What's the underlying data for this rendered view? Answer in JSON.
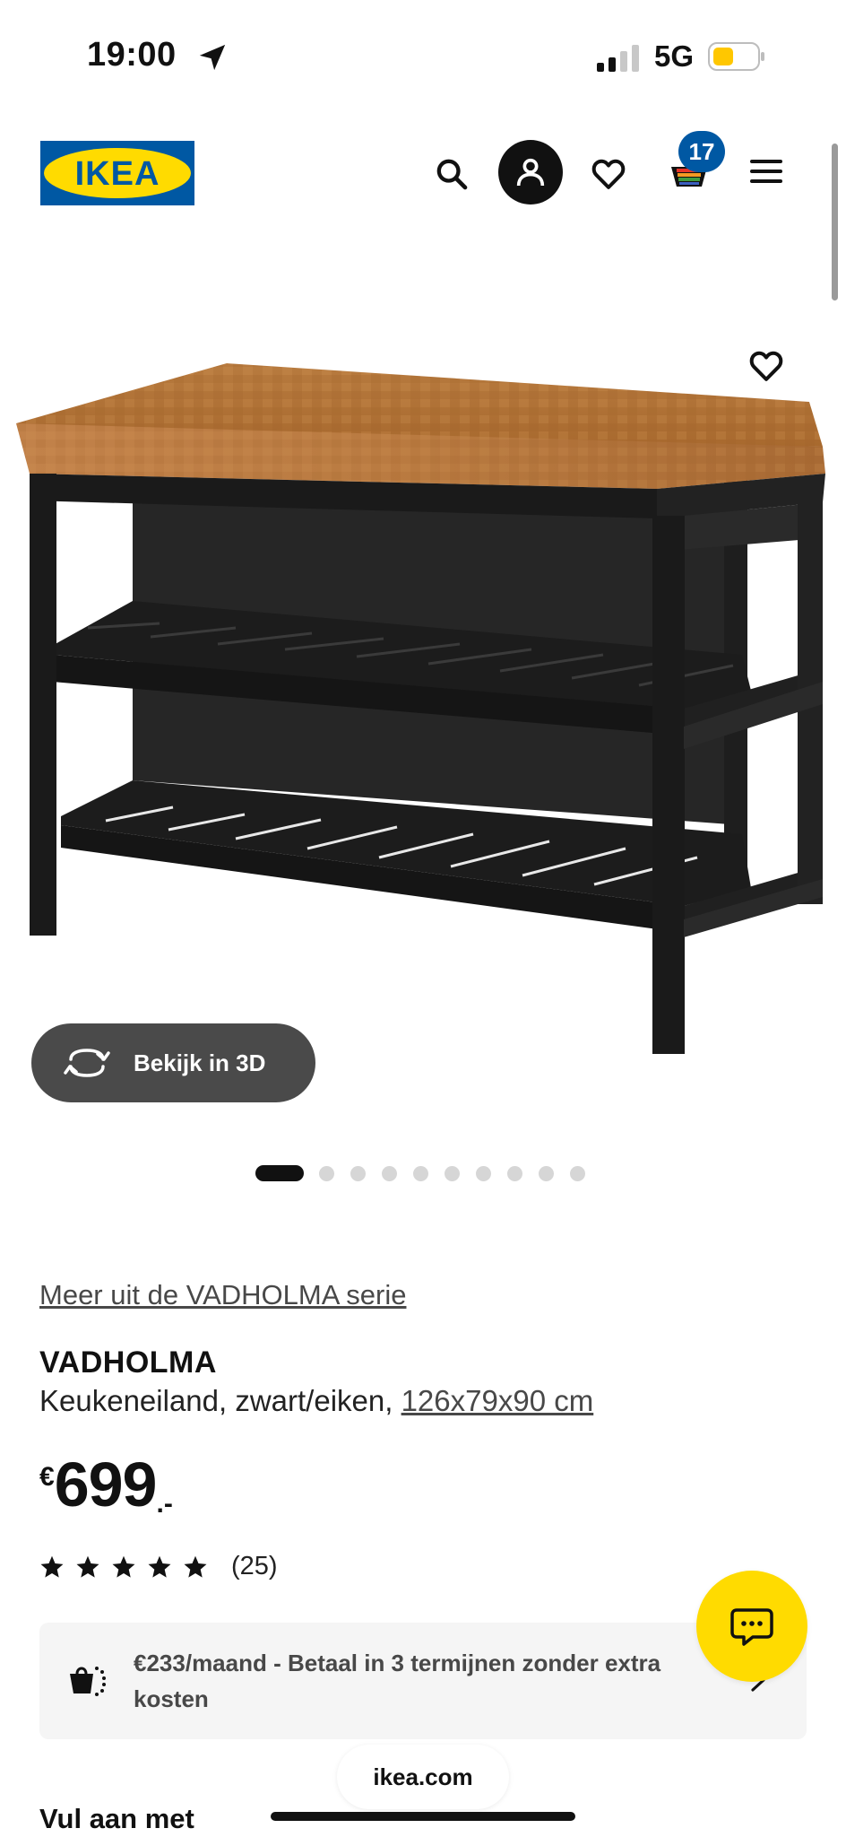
{
  "status_bar": {
    "time": "19:00",
    "network": "5G",
    "battery_color": "#ffc700"
  },
  "header": {
    "logo_text": "IKEA",
    "logo_colors": {
      "blue": "#0058a3",
      "yellow": "#ffdb00"
    },
    "cart_count": "17",
    "icons": [
      "search-icon",
      "account-icon",
      "heart-icon",
      "cart-icon",
      "hamburger-menu-icon"
    ]
  },
  "gallery": {
    "view_3d_label": "Bekijk in 3D",
    "image_count": 10,
    "active_index": 0
  },
  "product": {
    "series_link": "Meer uit de VADHOLMA serie",
    "name": "VADHOLMA",
    "description": "Keukeneiland, zwart/eiken,",
    "dimensions": "126x79x90 cm",
    "price_currency": "€",
    "price_value": "699",
    "price_suffix": ".-",
    "rating_stars": 5,
    "review_count": "(25)"
  },
  "payment": {
    "text": "€233/maand - Betaal in 3 termijnen zonder extra kosten"
  },
  "section_next": {
    "title": "Vul aan met"
  },
  "browser": {
    "url": "ikea.com"
  },
  "colors": {
    "chat_yellow": "#ffdb00",
    "badge_blue": "#0058a3"
  }
}
